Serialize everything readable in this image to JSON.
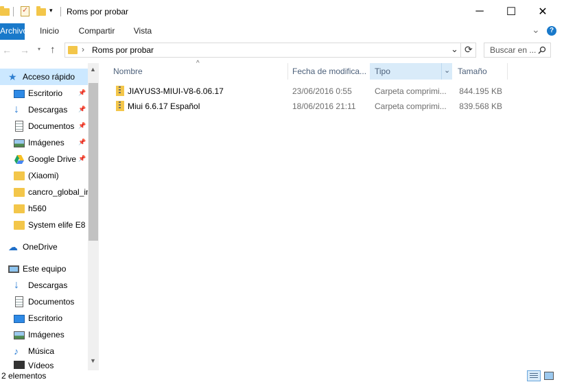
{
  "window": {
    "title": "Roms por probar",
    "minimize": "─",
    "maximize": "☐",
    "close": "✕"
  },
  "ribbon": {
    "tabs": [
      "Archivo",
      "Inicio",
      "Compartir",
      "Vista"
    ],
    "collapse": "⌄",
    "help": "?"
  },
  "address": {
    "path_separator": "›",
    "current": "Roms por probar",
    "dropdown": "⌄",
    "refresh": "⟳"
  },
  "search": {
    "placeholder": "Buscar en ...",
    "icon": "search-icon"
  },
  "sidebar": {
    "quick_access": "Acceso rápido",
    "quick_items": [
      {
        "label": "Escritorio",
        "icon": "desktop-icon",
        "pinned": true
      },
      {
        "label": "Descargas",
        "icon": "download-icon",
        "pinned": true
      },
      {
        "label": "Documentos",
        "icon": "document-icon",
        "pinned": true
      },
      {
        "label": "Imágenes",
        "icon": "pictures-icon",
        "pinned": true
      },
      {
        "label": "Google Drive",
        "icon": "google-drive-icon",
        "pinned": true
      },
      {
        "label": "(Xiaomi)",
        "icon": "folder-icon",
        "pinned": false
      },
      {
        "label": "cancro_global_in",
        "icon": "folder-icon",
        "pinned": false
      },
      {
        "label": "h560",
        "icon": "folder-icon",
        "pinned": false
      },
      {
        "label": "System elife E8",
        "icon": "folder-icon",
        "pinned": false
      }
    ],
    "onedrive": "OneDrive",
    "this_pc": "Este equipo",
    "pc_items": [
      {
        "label": "Descargas",
        "icon": "download-icon"
      },
      {
        "label": "Documentos",
        "icon": "document-icon"
      },
      {
        "label": "Escritorio",
        "icon": "desktop-icon"
      },
      {
        "label": "Imágenes",
        "icon": "pictures-icon"
      },
      {
        "label": "Música",
        "icon": "music-icon"
      },
      {
        "label": "Vídeos",
        "icon": "video-icon"
      }
    ],
    "pin_glyph": "📌"
  },
  "columns": {
    "name": "Nombre",
    "date": "Fecha de modifica...",
    "type": "Tipo",
    "size": "Tamaño",
    "sort_indicator": "^"
  },
  "files": [
    {
      "name": "JIAYUS3-MIUI-V8-6.06.17",
      "date": "23/06/2016 0:55",
      "type": "Carpeta comprimi...",
      "size": "844.195 KB"
    },
    {
      "name": "Miui 6.6.17 Español",
      "date": "18/06/2016 21:11",
      "type": "Carpeta comprimi...",
      "size": "839.568 KB"
    }
  ],
  "status": {
    "count": "2 elementos"
  },
  "colors": {
    "accent": "#1979ca",
    "selected_header": "#d9ebf9",
    "folder": "#f3c64a"
  }
}
